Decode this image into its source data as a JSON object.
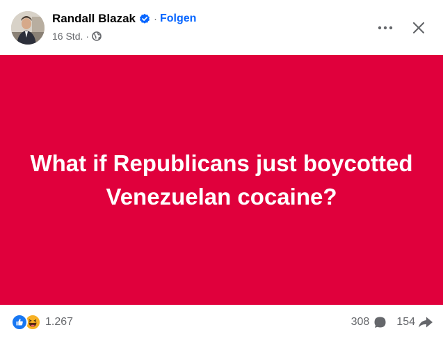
{
  "post": {
    "author": "Randall Blazak",
    "verified_icon": "verified-badge-icon",
    "separator": "·",
    "follow_label": "Folgen",
    "timestamp": "16 Std.",
    "audience_icon": "globe-icon",
    "text": "What if Republicans just boycotted Venezuelan cocaine?",
    "background_color": "#e0003c"
  },
  "toolbar": {
    "more_icon": "more-options-icon",
    "close_icon": "close-icon"
  },
  "footer": {
    "reaction_icons": [
      "like-icon",
      "haha-icon"
    ],
    "reaction_count": "1.267",
    "comment_count": "308",
    "share_count": "154"
  },
  "colors": {
    "accent": "#0866ff",
    "like": "#1877f2",
    "haha": "#f7b125",
    "secondary_text": "#65676b"
  }
}
